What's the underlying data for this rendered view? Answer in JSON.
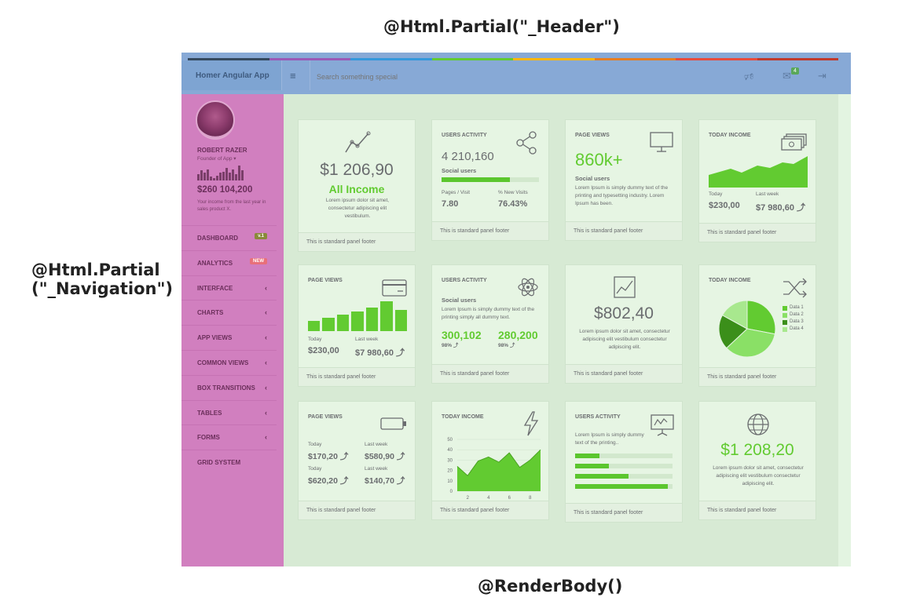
{
  "annotations": {
    "header": "@Html.Partial(\"_Header\")",
    "navigation_line1": "@Html.Partial",
    "navigation_line2": "(\"_Navigation\")",
    "body": "@RenderBody()"
  },
  "header": {
    "brand": "Homer Angular App",
    "menu_icon": "hamburger-icon",
    "search_placeholder": "Search something special",
    "badge": "4",
    "colorline": [
      "#34495e",
      "#9b59b6",
      "#3498db",
      "#62cb31",
      "#ffb606",
      "#e67e22",
      "#e74c3c",
      "#c0392b"
    ]
  },
  "profile": {
    "name": "ROBERT RAZER",
    "role": "Founder of App ▾",
    "value": "$260 104,200",
    "note": "Your income from the last year in sales product X.",
    "spark": [
      5,
      8,
      6,
      9,
      3,
      2,
      4,
      6,
      7,
      10,
      6,
      9,
      5,
      12,
      8
    ]
  },
  "nav": [
    {
      "label": "DASHBOARD",
      "tag": "v.1",
      "tag_color": "#8a8a3a"
    },
    {
      "label": "ANALYTICS",
      "tag": "NEW",
      "tag_color": "#e8707a"
    },
    {
      "label": "INTERFACE"
    },
    {
      "label": "CHARTS"
    },
    {
      "label": "APP VIEWS"
    },
    {
      "label": "COMMON VIEWS"
    },
    {
      "label": "BOX TRANSITIONS"
    },
    {
      "label": "TABLES"
    },
    {
      "label": "FORMS"
    },
    {
      "label": "GRID SYSTEM"
    }
  ],
  "footer": "This is standard panel footer",
  "p1": {
    "amount": "$1 206,90",
    "title": "All Income",
    "text": "Lorem ipsum dolor sit amet, consectetur adipiscing elit vestibulum."
  },
  "p2": {
    "label": "USERS ACTIVITY",
    "number": "4 210,160",
    "sub": "Social users",
    "progress": 0.7,
    "k1": "Pages / Visit",
    "k2": "% New Visits",
    "v1": "7.80",
    "v2": "76.43%"
  },
  "p3": {
    "label": "PAGE VIEWS",
    "number": "860k+",
    "sub": "Social users",
    "text": "Lorem Ipsum is simply dummy text of the printing and typesetting industry. Lorem Ipsum has been."
  },
  "p4": {
    "label": "TODAY INCOME",
    "k1": "Today",
    "k2": "Last week",
    "v1": "$230,00",
    "v2": "$7 980,60 ⤴"
  },
  "p5": {
    "label": "PAGE VIEWS",
    "k1": "Today",
    "k2": "Last week",
    "v1": "$230,00",
    "v2": "$7 980,60 ⤴",
    "bars": [
      0.35,
      0.45,
      0.55,
      0.65,
      0.8,
      1.0,
      0.7
    ]
  },
  "p6": {
    "label": "USERS ACTIVITY",
    "sub": "Social users",
    "text": "Lorem Ipsum is simply dummy text of the printing simply all dummy text.",
    "v1": "300,102",
    "v2": "280,200",
    "s1": "98% ⤴",
    "s2": "98% ⤴"
  },
  "p7": {
    "amount": "$802,40",
    "text": "Lorem ipsum dolor sit amet, consectetur adipiscing elit vestibulum consectetur adipiscing elit."
  },
  "p8": {
    "label": "TODAY INCOME",
    "legend": [
      "Data 1",
      "Data 2",
      "Data 3",
      "Data 4"
    ],
    "slices": [
      0.28,
      0.35,
      0.2,
      0.17
    ],
    "colors": [
      "#62cb31",
      "#8ae066",
      "#3b8f1a",
      "#a8e88e"
    ]
  },
  "p9": {
    "label": "PAGE VIEWS",
    "rows": [
      {
        "k1": "Today",
        "k2": "Last week",
        "v1": "$170,20 ⤴",
        "v2": "$580,90 ⤴"
      },
      {
        "k1": "Today",
        "k2": "Last week",
        "v1": "$620,20 ⤴",
        "v2": "$140,70 ⤴"
      }
    ]
  },
  "p10": {
    "label": "TODAY INCOME",
    "chart_data": {
      "type": "area",
      "x": [
        1,
        2,
        3,
        4,
        5,
        6,
        7,
        8,
        9
      ],
      "values": [
        24,
        15,
        29,
        33,
        28,
        37,
        23,
        30,
        40
      ],
      "yticks": [
        "50",
        "40",
        "30",
        "20",
        "10",
        "0"
      ],
      "xticks": [
        "2",
        "4",
        "6",
        "8"
      ],
      "ylim": [
        0,
        50
      ]
    }
  },
  "p11": {
    "label": "USERS ACTIVITY",
    "text": "Lorem Ipsum is simply dummy text of the printing..",
    "bars": [
      0.25,
      0.35,
      0.55,
      0.95
    ]
  },
  "p12": {
    "amount": "$1 208,20",
    "text": "Lorem ipsum dolor sit amet, consectetur adipiscing elit vestibulum consectetur adipiscing elit."
  }
}
